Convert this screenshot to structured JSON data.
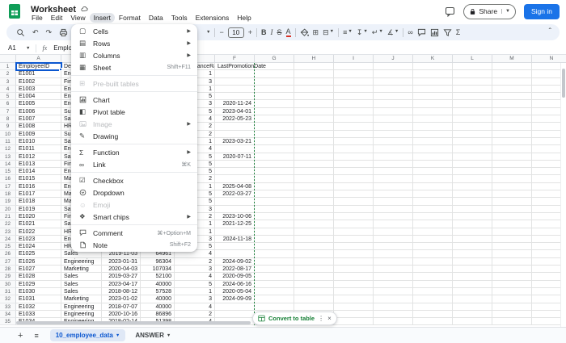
{
  "header": {
    "title": "Worksheet",
    "menus": [
      "File",
      "Edit",
      "View",
      "Insert",
      "Format",
      "Data",
      "Tools",
      "Extensions",
      "Help"
    ],
    "active_menu": "Insert",
    "share_label": "Share",
    "signin_label": "Sign in"
  },
  "toolbar": {
    "font_size": "10",
    "left": [
      {
        "n": "search-icon",
        "svg": "search"
      },
      {
        "n": "undo-icon",
        "g": "↶"
      },
      {
        "n": "redo-icon",
        "g": "↷"
      },
      {
        "n": "print-icon",
        "svg": "print"
      },
      {
        "n": "paint-format-icon",
        "svg": "roller"
      }
    ],
    "right": [
      {
        "t": "caret"
      },
      {
        "t": "div"
      },
      {
        "n": "decrease-font-size-icon",
        "g": "−"
      },
      {
        "t": "fontbox"
      },
      {
        "n": "increase-font-size-icon",
        "g": "+"
      },
      {
        "t": "div"
      },
      {
        "n": "bold-icon",
        "g": "B",
        "cls": "tbB"
      },
      {
        "n": "italic-icon",
        "g": "I",
        "cls": "tbI"
      },
      {
        "n": "strikethrough-icon",
        "g": "S",
        "cls": "tbS"
      },
      {
        "n": "text-color-icon",
        "g": "A",
        "cls": "tbA"
      },
      {
        "t": "div"
      },
      {
        "n": "fill-color-icon",
        "svg": "bucket"
      },
      {
        "n": "borders-icon",
        "g": "⊞"
      },
      {
        "n": "merge-cells-icon",
        "g": "⊟",
        "caret": true
      },
      {
        "t": "div"
      },
      {
        "n": "horizontal-align-icon",
        "g": "≡",
        "caret": true
      },
      {
        "n": "vertical-align-icon",
        "g": "↧",
        "caret": true
      },
      {
        "n": "text-wrap-icon",
        "g": "↵",
        "caret": true
      },
      {
        "n": "text-rotation-icon",
        "g": "∡",
        "caret": true
      },
      {
        "t": "div"
      },
      {
        "n": "insert-link-icon",
        "g": "∞"
      },
      {
        "n": "insert-comment-icon",
        "svg": "comment"
      },
      {
        "n": "insert-chart-icon",
        "svg": "chart"
      },
      {
        "n": "create-filter-icon",
        "svg": "filter"
      },
      {
        "n": "functions-icon",
        "g": "Σ"
      }
    ],
    "collapse_glyph": "ˆ"
  },
  "formula_bar": {
    "cell_ref": "A1",
    "value": "EmployeeID"
  },
  "insert_menu": {
    "groups": [
      {
        "items": [
          {
            "label": "Cells",
            "icon": "▢",
            "sub": true
          },
          {
            "label": "Rows",
            "icon": "▤",
            "sub": true
          },
          {
            "label": "Columns",
            "icon": "▥",
            "sub": true
          },
          {
            "label": "Sheet",
            "icon": "▦",
            "shortcut": "Shift+F11"
          }
        ]
      },
      {
        "items": [
          {
            "label": "Pre-built tables",
            "icon": "⊞",
            "disabled": true
          }
        ]
      },
      {
        "items": [
          {
            "label": "Chart",
            "svg": "chart"
          },
          {
            "label": "Pivot table",
            "icon": "◧"
          },
          {
            "label": "Image",
            "svg": "image",
            "disabled": true,
            "sub": true
          },
          {
            "label": "Drawing",
            "icon": "✎"
          }
        ]
      },
      {
        "items": [
          {
            "label": "Function",
            "icon": "Σ",
            "sub": true
          },
          {
            "label": "Link",
            "icon": "∞",
            "shortcut": "⌘K"
          }
        ]
      },
      {
        "items": [
          {
            "label": "Checkbox",
            "icon": "☑"
          },
          {
            "label": "Dropdown",
            "svg": "dropdown"
          },
          {
            "label": "Emoji",
            "icon": "☺",
            "disabled": true
          },
          {
            "label": "Smart chips",
            "icon": "❖",
            "sub": true
          }
        ]
      },
      {
        "items": [
          {
            "label": "Comment",
            "svg": "comment",
            "shortcut": "⌘+Option+M"
          },
          {
            "label": "Note",
            "svg": "note",
            "shortcut": "Shift+F2"
          }
        ]
      }
    ]
  },
  "grid": {
    "columns": [
      "A",
      "B",
      "C",
      "D",
      "E",
      "F",
      "G",
      "H",
      "I",
      "J",
      "K",
      "L",
      "M",
      "N"
    ],
    "header_row": [
      "EmployeeID",
      "Department",
      "",
      "",
      "PerformanceRating",
      "LastPromotionDate"
    ],
    "rows": [
      [
        "E1001",
        "Engineering",
        "",
        "",
        "1",
        ""
      ],
      [
        "E1002",
        "Finance",
        "",
        "",
        "3",
        ""
      ],
      [
        "E1003",
        "Engineering",
        "",
        "",
        "1",
        ""
      ],
      [
        "E1004",
        "Engineering",
        "",
        "",
        "5",
        ""
      ],
      [
        "E1005",
        "Engineering",
        "",
        "",
        "3",
        "2020-11-24"
      ],
      [
        "E1006",
        "Support",
        "",
        "",
        "5",
        "2023-04-01"
      ],
      [
        "E1007",
        "Sales",
        "",
        "",
        "4",
        "2022-05-23"
      ],
      [
        "E1008",
        "HR",
        "",
        "",
        "2",
        ""
      ],
      [
        "E1009",
        "Support",
        "",
        "",
        "2",
        ""
      ],
      [
        "E1010",
        "Sales",
        "",
        "",
        "1",
        "2023-03-21"
      ],
      [
        "E1011",
        "Engineering",
        "",
        "",
        "4",
        ""
      ],
      [
        "E1012",
        "Sales",
        "",
        "",
        "5",
        "2020-07-11"
      ],
      [
        "E1013",
        "Finance",
        "",
        "",
        "5",
        ""
      ],
      [
        "E1014",
        "Engineering",
        "",
        "",
        "5",
        ""
      ],
      [
        "E1015",
        "Marketing",
        "",
        "",
        "2",
        ""
      ],
      [
        "E1016",
        "Engineering",
        "",
        "",
        "1",
        "2025-04-08"
      ],
      [
        "E1017",
        "Marketing",
        "",
        "",
        "5",
        "2022-03-27"
      ],
      [
        "E1018",
        "Marketing",
        "",
        "",
        "5",
        ""
      ],
      [
        "E1019",
        "Sales",
        "",
        "",
        "3",
        ""
      ],
      [
        "E1020",
        "Finance",
        "",
        "",
        "2",
        "2023-10-06"
      ],
      [
        "E1021",
        "Sales",
        "",
        "",
        "1",
        "2021-12-25"
      ],
      [
        "E1022",
        "HR",
        "",
        "",
        "1",
        ""
      ],
      [
        "E1023",
        "Engineering",
        "",
        "",
        "3",
        "2024-11-18"
      ],
      [
        "E1024",
        "HR",
        "",
        "",
        "5",
        ""
      ],
      [
        "E1025",
        "Sales",
        "2019-11-03",
        "64961",
        "4",
        ""
      ],
      [
        "E1026",
        "Engineering",
        "2023-01-31",
        "96304",
        "2",
        "2024-09-02"
      ],
      [
        "E1027",
        "Marketing",
        "2020-04-03",
        "107034",
        "3",
        "2022-08-17"
      ],
      [
        "E1028",
        "Sales",
        "2019-03-27",
        "52100",
        "4",
        "2020-09-05"
      ],
      [
        "E1029",
        "Sales",
        "2023-04-17",
        "40000",
        "5",
        "2024-06-16"
      ],
      [
        "E1030",
        "Sales",
        "2018-08-12",
        "57528",
        "1",
        "2020-05-04"
      ],
      [
        "E1031",
        "Marketing",
        "2023-01-02",
        "40000",
        "3",
        "2024-09-09"
      ],
      [
        "E1032",
        "Engineering",
        "2018-07-07",
        "40000",
        "4",
        ""
      ],
      [
        "E1033",
        "Engineering",
        "2020-10-16",
        "86896",
        "2",
        ""
      ],
      [
        "E1034",
        "Engineering",
        "2018-02-14",
        "51398",
        "4",
        ""
      ]
    ]
  },
  "convert_chip": {
    "label": "Convert to table"
  },
  "sheet_tabs": {
    "active": "10_employee_data",
    "other": "ANSWER"
  },
  "colors": {
    "accent_blue": "#0b57d0",
    "signin_blue": "#1a73e8",
    "sheets_green": "#0f9d58",
    "chip_green": "#188038",
    "toolbar_bg": "#edf2fa",
    "active_tab_bg": "#dfe8f6"
  }
}
